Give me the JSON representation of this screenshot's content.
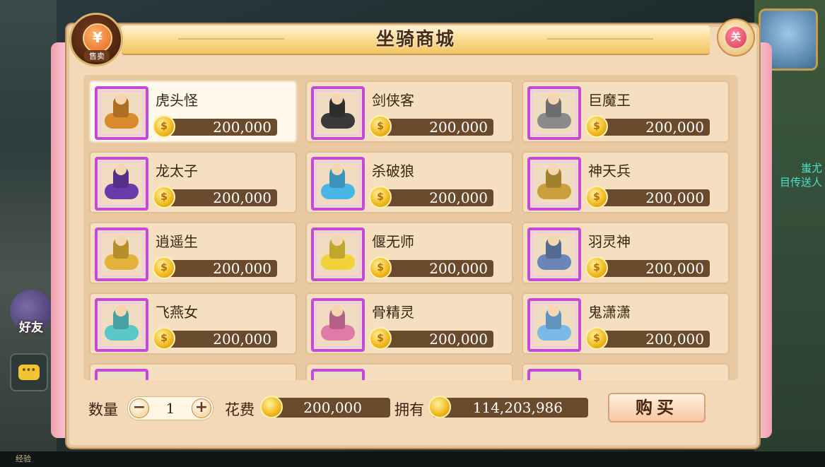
{
  "window": {
    "title": "坐骑商城"
  },
  "sell_button": {
    "glyph": "¥",
    "label": "售卖"
  },
  "close_button": {
    "label": "关"
  },
  "background": {
    "friends_label": "好友",
    "exp_label": "经验",
    "right_text_1": "蚩尤",
    "right_text_2": "目传送人"
  },
  "items": [
    {
      "name": "虎头怪",
      "price": "200,000",
      "selected": true,
      "color": "#d98a2c"
    },
    {
      "name": "剑侠客",
      "price": "200,000",
      "selected": false,
      "color": "#3a3a3a"
    },
    {
      "name": "巨魔王",
      "price": "200,000",
      "selected": false,
      "color": "#8a8a8a"
    },
    {
      "name": "龙太子",
      "price": "200,000",
      "selected": false,
      "color": "#6a3aa8"
    },
    {
      "name": "杀破狼",
      "price": "200,000",
      "selected": false,
      "color": "#4ab6e8"
    },
    {
      "name": "神天兵",
      "price": "200,000",
      "selected": false,
      "color": "#c9a03a"
    },
    {
      "name": "逍遥生",
      "price": "200,000",
      "selected": false,
      "color": "#e2b23a"
    },
    {
      "name": "偃无师",
      "price": "200,000",
      "selected": false,
      "color": "#f2d13a"
    },
    {
      "name": "羽灵神",
      "price": "200,000",
      "selected": false,
      "color": "#6a86b6"
    },
    {
      "name": "飞燕女",
      "price": "200,000",
      "selected": false,
      "color": "#5ac8c8"
    },
    {
      "name": "骨精灵",
      "price": "200,000",
      "selected": false,
      "color": "#e07aa8"
    },
    {
      "name": "鬼潇潇",
      "price": "200,000",
      "selected": false,
      "color": "#7ab8ea"
    }
  ],
  "footer": {
    "quantity_label": "数量",
    "quantity_value": "1",
    "minus_glyph": "−",
    "plus_glyph": "+",
    "cost_label": "花费",
    "cost_value": "200,000",
    "own_label": "拥有",
    "own_value": "114,203,986",
    "buy_label": "购买"
  },
  "coin_glyph": "$"
}
